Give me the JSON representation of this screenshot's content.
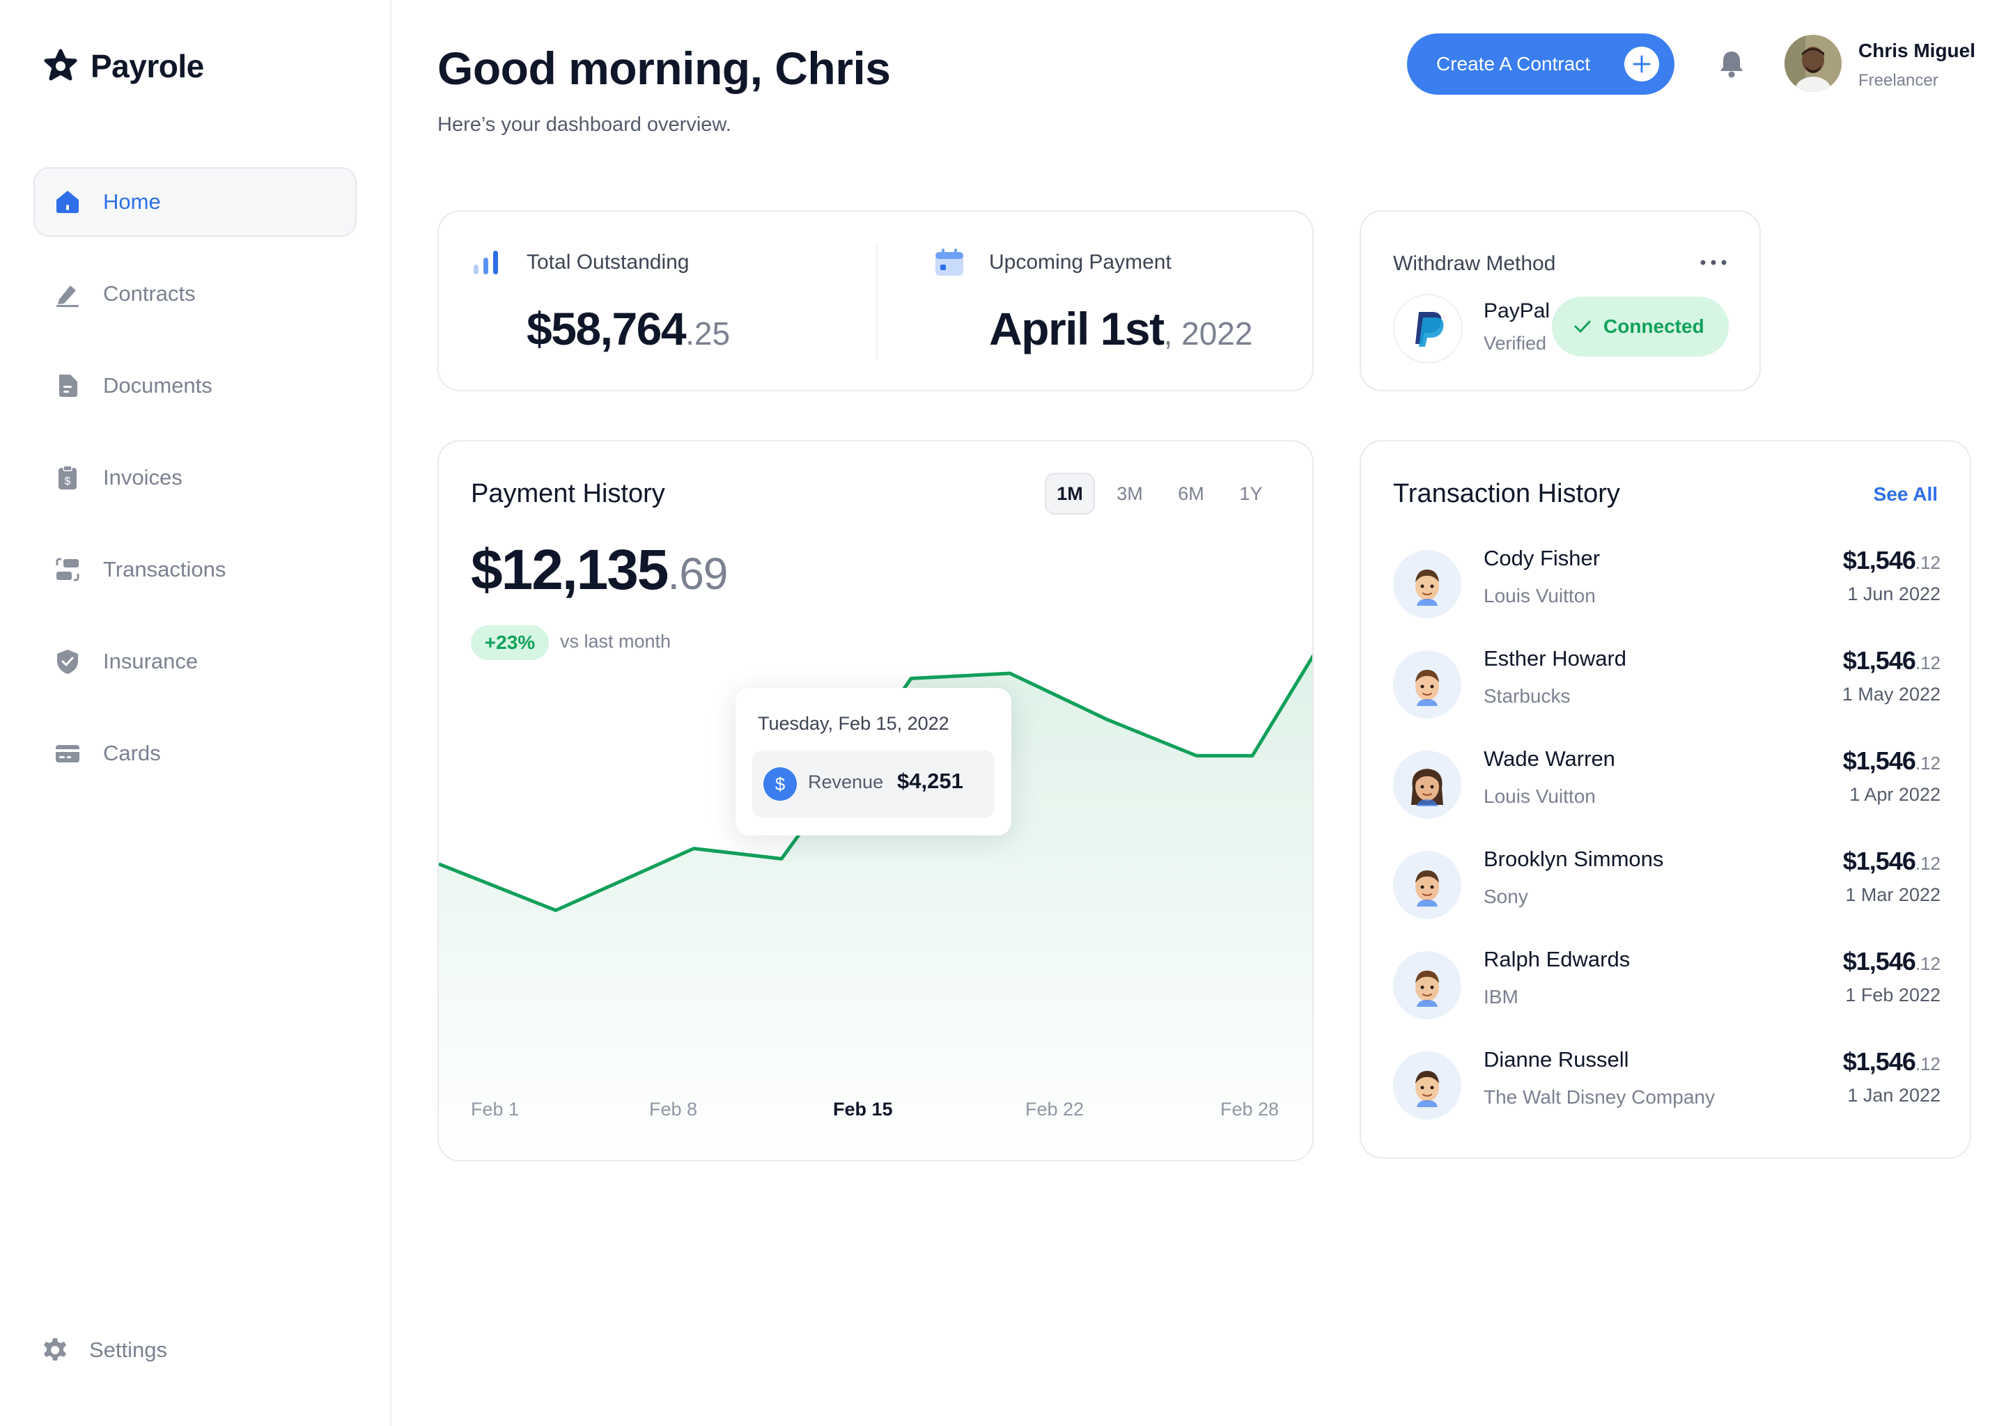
{
  "app": {
    "name": "Payrole"
  },
  "colors": {
    "accent": "#3a7ef0",
    "success": "#10a25a",
    "success_bg": "#d6f5e3",
    "line": "#12a05a"
  },
  "sidebar": {
    "items": [
      {
        "label": "Home",
        "icon": "home-icon",
        "active": true
      },
      {
        "label": "Contracts",
        "icon": "pen-icon"
      },
      {
        "label": "Documents",
        "icon": "document-icon"
      },
      {
        "label": "Invoices",
        "icon": "invoice-icon"
      },
      {
        "label": "Transactions",
        "icon": "transactions-icon"
      },
      {
        "label": "Insurance",
        "icon": "shield-icon"
      },
      {
        "label": "Cards",
        "icon": "card-icon"
      }
    ],
    "settings_label": "Settings"
  },
  "header": {
    "greeting": "Good morning, Chris",
    "subtitle": "Here’s your dashboard overview.",
    "create_label": "Create A Contract",
    "user_name": "Chris Miguel",
    "user_role": "Freelancer"
  },
  "stats": {
    "outstanding": {
      "label": "Total Outstanding",
      "value_main": "$58,764",
      "value_dec": ".25"
    },
    "upcoming": {
      "label": "Upcoming Payment",
      "value_main": "April 1st",
      "value_dec": ", 2022"
    }
  },
  "withdraw": {
    "title": "Withdraw Method",
    "provider": "PayPal",
    "status": "Verified",
    "badge": "Connected"
  },
  "payment_history": {
    "title": "Payment History",
    "ranges": [
      "1M",
      "3M",
      "6M",
      "1Y"
    ],
    "active_range": "1M",
    "amount_main": "$12,135",
    "amount_dec": ".69",
    "growth": "+23%",
    "growth_label": "vs last month",
    "tooltip": {
      "date": "Tuesday, Feb 15, 2022",
      "label": "Revenue",
      "value": "$4,251"
    },
    "x_labels": [
      "Feb 1",
      "Feb 8",
      "Feb 15",
      "Feb 22",
      "Feb 28"
    ],
    "active_x": "Feb 15"
  },
  "chart_data": {
    "type": "area",
    "x": [
      "Jan 31",
      "Feb 3",
      "Feb 7",
      "Feb 9",
      "Feb 15",
      "Feb 16",
      "Feb 18",
      "Feb 21",
      "Feb 24",
      "Feb 28",
      "Mar 1"
    ],
    "series": [
      {
        "values": [
          2900,
          2450,
          3050,
          2950,
          4251,
          4700,
          4750,
          4300,
          3950,
          3950,
          4950
        ]
      }
    ],
    "ylim": [
      0,
      7000
    ],
    "highlight": {
      "x": "Feb 15",
      "value": 4251
    },
    "title": "",
    "xlabel": "",
    "ylabel": "",
    "grid": false
  },
  "transactions": {
    "title": "Transaction History",
    "see_all": "See All",
    "items": [
      {
        "name": "Cody Fisher",
        "company": "Louis Vuitton",
        "amount_main": "$1,546",
        "amount_dec": ".12",
        "date": "1 Jun 2022"
      },
      {
        "name": "Esther Howard",
        "company": "Starbucks",
        "amount_main": "$1,546",
        "amount_dec": ".12",
        "date": "1 May 2022"
      },
      {
        "name": "Wade Warren",
        "company": "Louis Vuitton",
        "amount_main": "$1,546",
        "amount_dec": ".12",
        "date": "1 Apr 2022"
      },
      {
        "name": "Brooklyn Simmons",
        "company": "Sony",
        "amount_main": "$1,546",
        "amount_dec": ".12",
        "date": "1 Mar 2022"
      },
      {
        "name": "Ralph Edwards",
        "company": "IBM",
        "amount_main": "$1,546",
        "amount_dec": ".12",
        "date": "1 Feb 2022"
      },
      {
        "name": "Dianne Russell",
        "company": "The Walt Disney Company",
        "amount_main": "$1,546",
        "amount_dec": ".12",
        "date": "1 Jan 2022"
      }
    ]
  }
}
